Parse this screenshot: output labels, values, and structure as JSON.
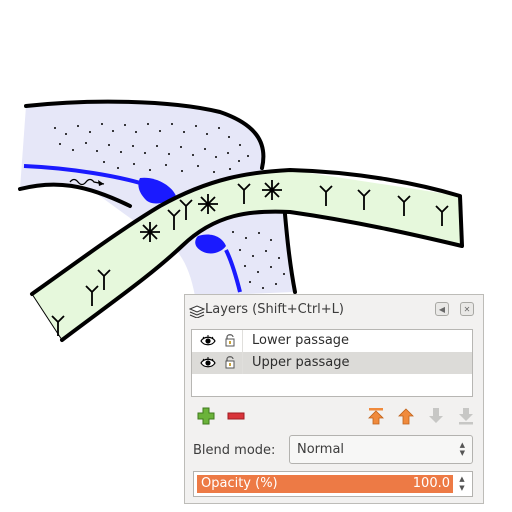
{
  "layers_panel": {
    "title": "Layers (Shift+Ctrl+L)",
    "layers": [
      {
        "name": "Lower passage",
        "visible": true,
        "locked": false,
        "selected": false
      },
      {
        "name": "Upper passage",
        "visible": true,
        "locked": false,
        "selected": true
      }
    ],
    "toolbar_icons": [
      "add-layer-icon",
      "remove-layer-icon",
      "raise-to-top-icon",
      "raise-layer-icon",
      "lower-layer-icon",
      "lower-to-bottom-icon"
    ],
    "blend_mode_label": "Blend mode:",
    "blend_mode_value": "Normal",
    "opacity_label": "Opacity (%)",
    "opacity_value": "100.0",
    "opacity_fraction": 1.0
  },
  "colors": {
    "lower_passage_fill": "#e6e7f8",
    "upper_passage_fill": "#e6f8dc",
    "water": "#1a1aff",
    "outline": "#000000",
    "accent": "#ed7a45",
    "add_green": "#6bb33a",
    "remove_red": "#d9343a"
  }
}
